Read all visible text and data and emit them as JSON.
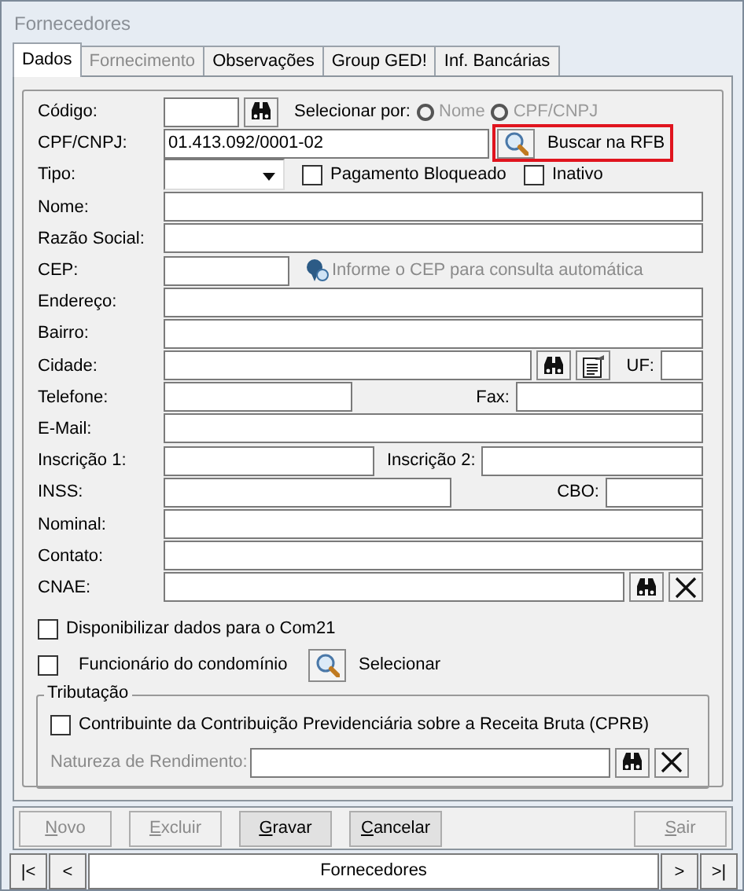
{
  "window": {
    "title": "Fornecedores"
  },
  "tabs": [
    {
      "label": "Dados",
      "selected": true,
      "disabled": false
    },
    {
      "label": "Fornecimento",
      "selected": false,
      "disabled": true
    },
    {
      "label": "Observações",
      "selected": false,
      "disabled": false
    },
    {
      "label": "Group GED!",
      "selected": false,
      "disabled": false
    },
    {
      "label": "Inf. Bancárias",
      "selected": false,
      "disabled": false
    }
  ],
  "rows": [
    {
      "kind": "code",
      "label": "Código:",
      "select_label": "Selecionar por:",
      "options": [
        {
          "label": "Nome",
          "selected": false,
          "disabled": true
        },
        {
          "label": "CPF/CNPJ",
          "selected": false,
          "disabled": true
        }
      ]
    },
    {
      "kind": "document",
      "label": "CPF/CNPJ:",
      "value": "01.413.092/0001-02",
      "button": "Buscar na RFB",
      "highlighted": true
    },
    {
      "kind": "type",
      "label": "Tipo:",
      "checkboxes": [
        {
          "label": "Pagamento Bloqueado",
          "checked": false
        },
        {
          "label": "Inativo",
          "checked": false
        }
      ]
    },
    {
      "kind": "text",
      "label": "Nome:"
    },
    {
      "kind": "text",
      "label": "Razão Social:"
    },
    {
      "kind": "cep",
      "label": "CEP:",
      "hint": "Informe o CEP para consulta automática"
    },
    {
      "kind": "text",
      "label": "Endereço:"
    },
    {
      "kind": "text",
      "label": "Bairro:"
    },
    {
      "kind": "city",
      "label": "Cidade:",
      "label_2": "UF:"
    },
    {
      "kind": "pair",
      "label": "Telefone:",
      "label_2": "Fax:"
    },
    {
      "kind": "text",
      "label": "E-Mail:"
    },
    {
      "kind": "pair",
      "label": "Inscrição 1:",
      "label_2": "Inscrição 2:"
    },
    {
      "kind": "pair",
      "label": "INSS:",
      "label_2": "CBO:"
    },
    {
      "kind": "text",
      "label": "Nominal:"
    },
    {
      "kind": "text",
      "label": "Contato:"
    },
    {
      "kind": "lookup",
      "label": "CNAE:"
    },
    {
      "kind": "check",
      "label": "Disponibilizar dados para o Com21",
      "checked": false
    },
    {
      "kind": "check_select",
      "label": "Funcionário do condomínio",
      "checked": false,
      "button": "Selecionar"
    }
  ],
  "tax_group": {
    "title": "Tributação",
    "checkbox": {
      "label": "Contribuinte da Contribuição Previdenciária sobre a Receita Bruta (CPRB)",
      "checked": false
    },
    "field": {
      "label": "Natureza de Rendimento:",
      "disabled": true
    }
  },
  "buttons": [
    {
      "label": "Novo",
      "disabled": true
    },
    {
      "label": "Excluir",
      "disabled": true
    },
    {
      "label": "Gravar",
      "disabled": false
    },
    {
      "label": "Cancelar",
      "disabled": false
    },
    {
      "label": "Sair",
      "disabled": true
    }
  ],
  "navigator": {
    "first": "|<",
    "prev": "<",
    "title": "Fornecedores",
    "next": ">",
    "last": ">|"
  }
}
